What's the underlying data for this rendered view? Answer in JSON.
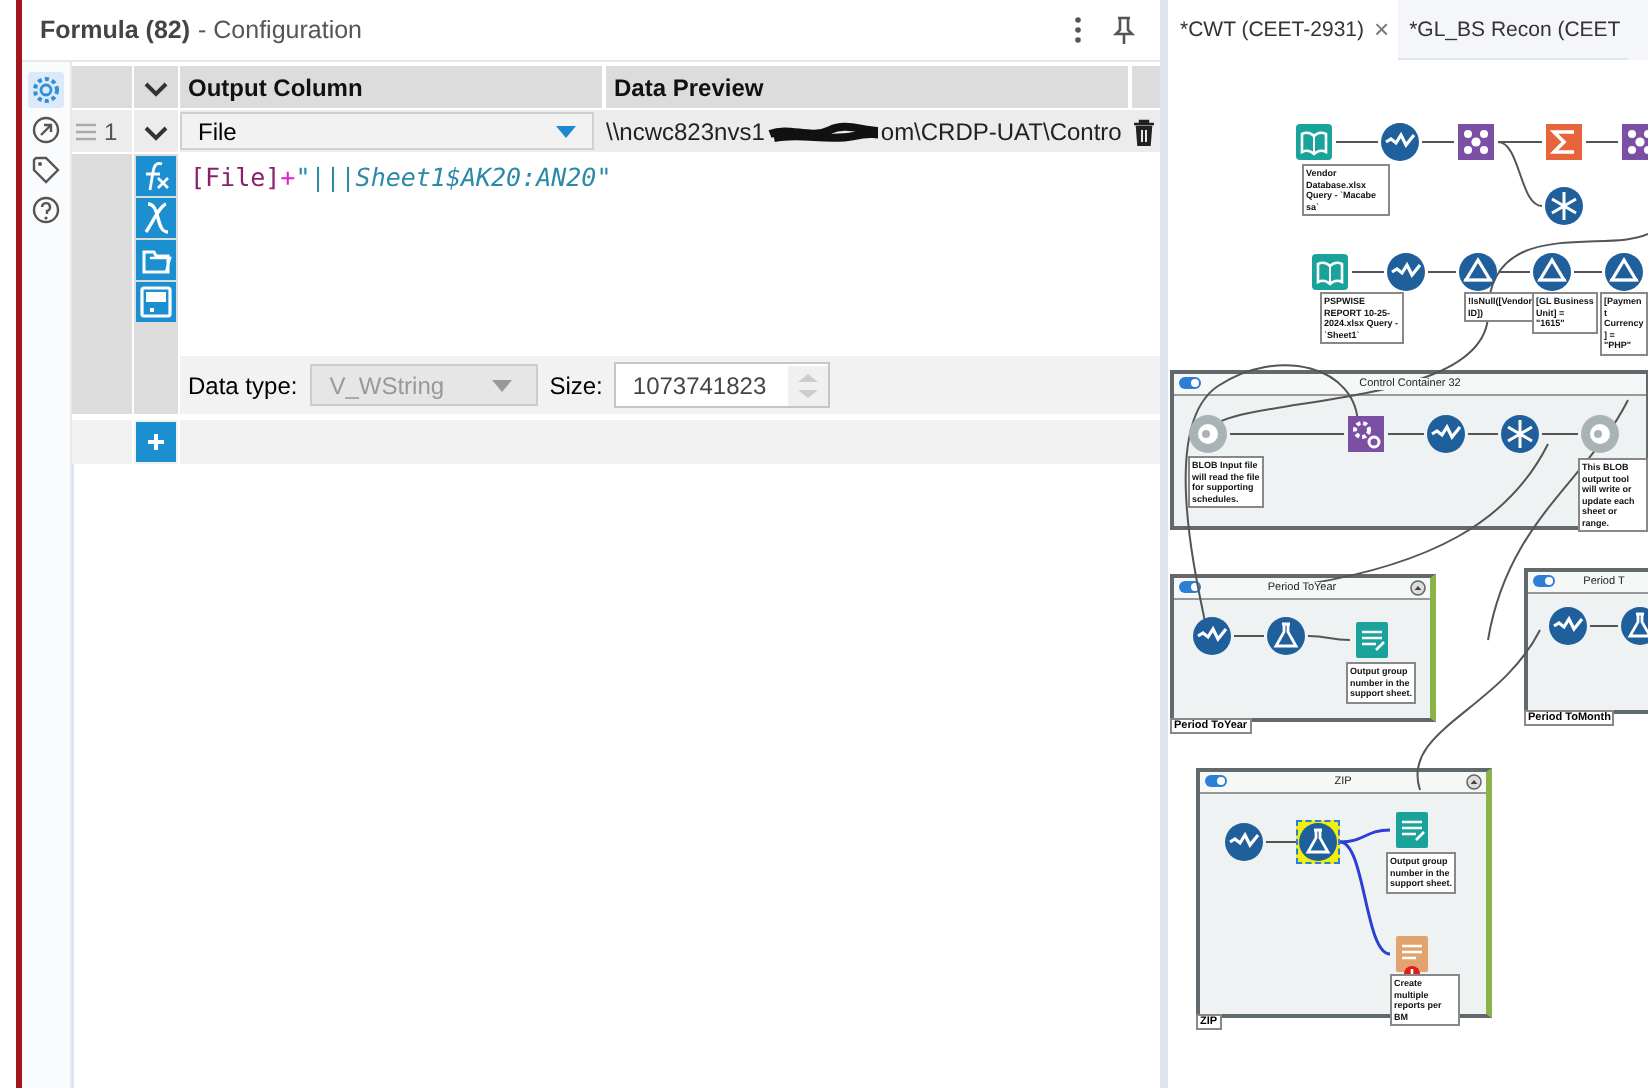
{
  "panel": {
    "title": "Formula (82)",
    "subtitle": "- Configuration"
  },
  "sidebar": [
    {
      "kind": "gear",
      "selected": true
    },
    {
      "kind": "arrow",
      "selected": false
    },
    {
      "kind": "tag",
      "selected": false
    },
    {
      "kind": "help",
      "selected": false
    }
  ],
  "grid": {
    "columns": [
      "Output Column",
      "Data Preview"
    ],
    "rows": [
      {
        "number": "1",
        "output_column": "File",
        "preview_start": "\\\\ncwc823nvs1",
        "preview_end": "om\\CRDP-UAT\\Contro",
        "expression": [
          {
            "kind": "field",
            "text": "[File]"
          },
          {
            "kind": "operator",
            "text": "+"
          },
          {
            "kind": "string",
            "text": "\"|||Sheet1$AK20:AN20\""
          }
        ],
        "data_type_label": "Data type:",
        "data_type": "V_WString",
        "data_type_disabled": true,
        "size_label": "Size:",
        "size": "1073741823"
      }
    ]
  },
  "tabs": [
    {
      "label": "*CWT (CEET-2931)",
      "selected": true,
      "close": "×"
    },
    {
      "label": "*GL_BS Recon (CEET",
      "selected": false
    }
  ],
  "canvas": {
    "containers": [
      {
        "title": "Control Container 32"
      },
      {
        "title": "Period ToYear",
        "label": "Period ToYear"
      },
      {
        "title": "Period T",
        "label": "Period ToMonth"
      },
      {
        "title": "ZIP",
        "label": "ZIP"
      }
    ],
    "tools": [
      {
        "kind": "input",
        "selected": false,
        "error": false
      },
      {
        "kind": "select",
        "selected": false,
        "error": false
      },
      {
        "kind": "join",
        "selected": false,
        "error": false
      },
      {
        "kind": "summarize",
        "selected": false,
        "error": false
      },
      {
        "kind": "join",
        "selected": false,
        "error": false
      },
      {
        "kind": "union",
        "selected": false,
        "error": false
      },
      {
        "kind": "input",
        "selected": false,
        "error": false
      },
      {
        "kind": "select",
        "selected": false,
        "error": false
      },
      {
        "kind": "filter",
        "selected": false,
        "error": false
      },
      {
        "kind": "filter",
        "selected": false,
        "error": false
      },
      {
        "kind": "filter",
        "selected": false,
        "error": false
      },
      {
        "kind": "blob",
        "selected": false,
        "error": false
      },
      {
        "kind": "macro",
        "selected": false,
        "error": false
      },
      {
        "kind": "select",
        "selected": false,
        "error": false
      },
      {
        "kind": "union",
        "selected": false,
        "error": false
      },
      {
        "kind": "blob",
        "selected": false,
        "error": false
      },
      {
        "kind": "select",
        "selected": false,
        "error": false
      },
      {
        "kind": "formula",
        "selected": false,
        "error": false
      },
      {
        "kind": "render",
        "selected": false,
        "error": false
      },
      {
        "kind": "select",
        "selected": false,
        "error": false
      },
      {
        "kind": "formula",
        "selected": false,
        "error": false
      },
      {
        "kind": "select",
        "selected": false,
        "error": false
      },
      {
        "kind": "formula",
        "selected": true,
        "error": false
      },
      {
        "kind": "render",
        "selected": false,
        "error": false
      },
      {
        "kind": "report",
        "selected": false,
        "error": true
      }
    ],
    "annotations": [
      "Vendor Database.xlsx Query - `Macabe sa`",
      "PSPWISE REPORT 10-25-2024.xlsx Query - `Sheet1`",
      "!IsNull([Vendor ID])",
      "[GL Business Unit] = \"1615\"",
      "[Payment Currency] = \"PHP\"",
      "BLOB Input file will read the file for supporting schedules.",
      "This BLOB output tool will write or update each sheet or range.",
      "Output group number in the support sheet.",
      "Output group number in the support sheet.",
      "Create multiple reports per BM"
    ]
  }
}
